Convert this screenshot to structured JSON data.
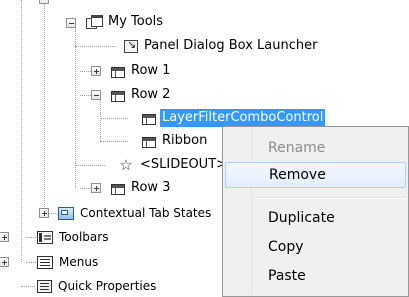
{
  "tree": {
    "nodes": {
      "my_tools": "My Tools",
      "panel_dialog_box_launcher": "Panel Dialog Box Launcher",
      "row1": "Row 1",
      "row2": "Row 2",
      "layer_filter": "LayerFilterComboControl",
      "ribbon": "Ribbon",
      "slideout": "<SLIDEOUT>",
      "row3": "Row 3",
      "contextual_tab_states": "Contextual Tab States",
      "toolbars": "Toolbars",
      "menus": "Menus",
      "quick_properties": "Quick Properties"
    },
    "selected_color": "#3399ff"
  },
  "context_menu": {
    "items": {
      "rename": "Rename",
      "remove": "Remove",
      "duplicate": "Duplicate",
      "copy": "Copy",
      "paste": "Paste"
    },
    "hovered_item": "Remove",
    "disabled_item": "Rename"
  }
}
